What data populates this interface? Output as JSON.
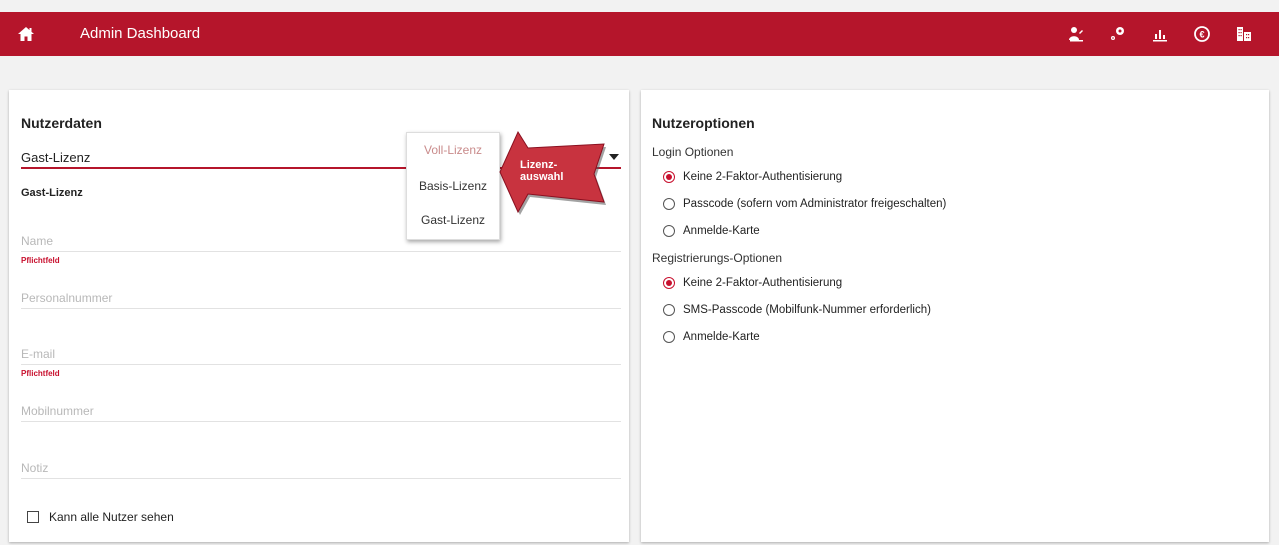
{
  "header": {
    "title": "Admin Dashboard",
    "icons": [
      "home-icon",
      "users-icon",
      "settings-icon",
      "chart-icon",
      "euro-icon",
      "buildings-icon"
    ],
    "bg_color": "#b5152b"
  },
  "left": {
    "title": "Nutzerdaten",
    "license_select": {
      "value": "Gast-Lizenz",
      "options": [
        "Voll-Lizenz",
        "Basis-Lizenz",
        "Gast-Lizenz"
      ]
    },
    "selected_license_label": "Gast-Lizenz",
    "callout": {
      "line1": "Lizenz-",
      "line2": "auswahl"
    },
    "fields": {
      "name": {
        "placeholder": "Name",
        "hint": "Pflichtfeld"
      },
      "personalnummer": {
        "placeholder": "Personalnummer"
      },
      "email": {
        "placeholder": "E-mail",
        "hint": "Pflichtfeld"
      },
      "mobilnummer": {
        "placeholder": "Mobilnummer"
      },
      "notiz": {
        "placeholder": "Notiz"
      }
    },
    "checkbox": {
      "label": "Kann alle Nutzer sehen",
      "checked": false
    }
  },
  "right": {
    "title": "Nutzeroptionen",
    "login": {
      "label": "Login Optionen",
      "options": [
        {
          "label": "Keine 2-Faktor-Authentisierung",
          "checked": true
        },
        {
          "label": "Passcode (sofern vom Administrator freigeschalten)",
          "checked": false
        },
        {
          "label": "Anmelde-Karte",
          "checked": false
        }
      ]
    },
    "registration": {
      "label": "Registrierungs-Optionen",
      "options": [
        {
          "label": "Keine 2-Faktor-Authentisierung",
          "checked": true
        },
        {
          "label": "SMS-Passcode (Mobilfunk-Nummer erforderlich)",
          "checked": false
        },
        {
          "label": "Anmelde-Karte",
          "checked": false
        }
      ]
    }
  },
  "accent_color": "#c8102e"
}
